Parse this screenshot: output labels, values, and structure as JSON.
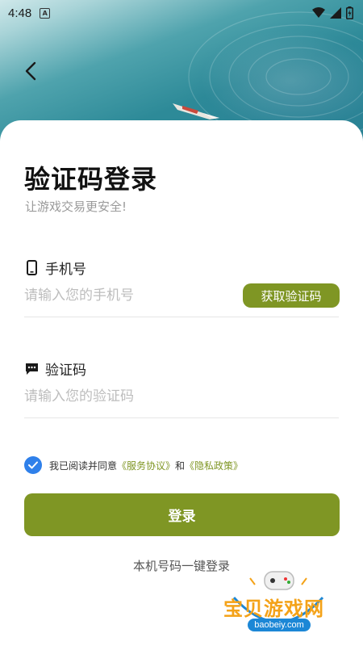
{
  "status_bar": {
    "time": "4:48",
    "notification_icon": "a-app-icon",
    "icons": [
      "wifi-icon",
      "signal-icon",
      "battery-icon"
    ]
  },
  "nav": {
    "back_icon": "chevron-left-icon"
  },
  "page": {
    "title": "验证码登录",
    "subtitle": "让游戏交易更安全!"
  },
  "phone_field": {
    "label": "手机号",
    "icon": "phone-icon",
    "placeholder": "请输入您的手机号",
    "value": "",
    "get_code_label": "获取验证码"
  },
  "code_field": {
    "label": "验证码",
    "icon": "message-icon",
    "placeholder": "请输入您的验证码",
    "value": ""
  },
  "agreement": {
    "checked": true,
    "prefix": "我已阅读并同意",
    "service_link": "《服务协议》",
    "and": "和",
    "privacy_link": "《隐私政策》"
  },
  "login_button": "登录",
  "one_key_login": "本机号码一键登录",
  "watermark": {
    "text": "宝贝游戏网",
    "url": "baobeiy.com"
  },
  "colors": {
    "accent": "#7f9624",
    "check": "#2f80ea",
    "watermark_orange": "#f4a218",
    "watermark_blue": "#1c87d6"
  }
}
